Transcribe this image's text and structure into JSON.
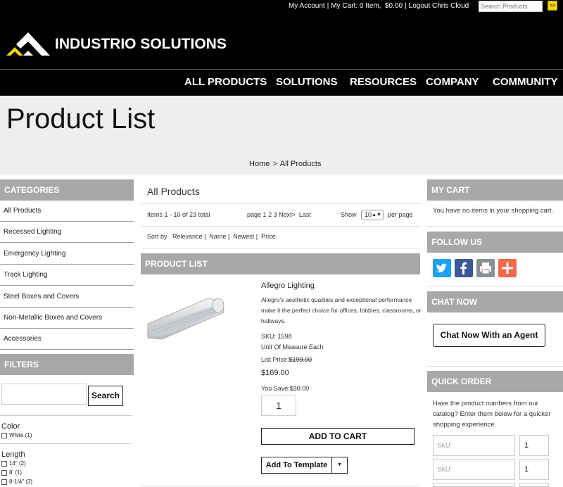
{
  "utility": {
    "my_account": "My Account",
    "my_cart": "My Cart: 0 Item,",
    "cart_total": "$0.00",
    "logout": "Logout Chris Cloud",
    "search_placeholder": "Search Products",
    "search_go": ">>"
  },
  "header": {
    "brand": "INDUSTRIO SOLUTIONS"
  },
  "nav": {
    "items": [
      "ALL PRODUCTS",
      "SOLUTIONS",
      "RESOURCES",
      "COMPANY",
      "COMMUNITY"
    ]
  },
  "hero": {
    "title": "Product List",
    "breadcrumb": {
      "home": "Home",
      "sep": ">",
      "current": "All Products"
    }
  },
  "sidebar": {
    "categories_title": "CATEGORIES",
    "categories": [
      "All Products",
      "Recessed Lighting",
      "Emergency Lighting",
      "Track Lighting",
      "Steel Boxes and Covers",
      "Non-Metallic Boxes and Covers",
      "Accessories"
    ],
    "filters_title": "FILTERS",
    "search_button": "Search",
    "facets": [
      {
        "label": "Color",
        "options": [
          "White (1)"
        ]
      },
      {
        "label": "Length",
        "options": [
          "14\" (2)",
          "8' (1)",
          "8-1/4\" (3)"
        ]
      }
    ]
  },
  "main": {
    "heading": "All Products",
    "items_range": "Items 1 - 10 of 23 total",
    "pagination": {
      "label": "page",
      "pages": [
        "1",
        "2",
        "3"
      ],
      "next": "Next>",
      "last": "Last"
    },
    "show_label": "Show",
    "per_page_value": "10",
    "per_page_label": "per page",
    "sort": {
      "label": "Sort by",
      "options": [
        "Relevance",
        "Name",
        "Newest",
        "Price"
      ]
    },
    "list_title": "PRODUCT LIST",
    "product": {
      "name": "Allegro Lighting",
      "description": "Allegro's aesthetic qualities and exceptional performance make it the perfect choice for offices, lobbies, classrooms, or hallways.",
      "sku": "SKU: 1598",
      "uom": "Unit Of Measure Each",
      "list_price_label": "List Price:",
      "list_price": "$199.00",
      "price": "$169.00",
      "you_save": "You Save:$30.00",
      "quantity": "1",
      "add_to_cart": "ADD TO CART",
      "add_to_template": "Add To Template"
    }
  },
  "right": {
    "cart_title": "MY CART",
    "cart_empty": "You have no items in your shopping cart.",
    "follow_title": "FOLLOW US",
    "chat_title": "CHAT NOW",
    "chat_button": "Chat Now With an Agent",
    "quick_title": "QUICK ORDER",
    "quick_text": "Have the product numbers from our catalog? Enter them below for a quicker shopping experience.",
    "sku_placeholder": "SKU",
    "rows": [
      {
        "qty": "1"
      },
      {
        "qty": "1"
      }
    ]
  },
  "colors": {
    "header_bg": "#000000",
    "section_gray": "#a8a8a8",
    "hero_bg": "#eeeeee",
    "accent_yellow": "#f4d800",
    "twitter": "#1da1f2",
    "facebook": "#3b5998",
    "print": "#8a8f93",
    "share": "#f26a4b"
  }
}
